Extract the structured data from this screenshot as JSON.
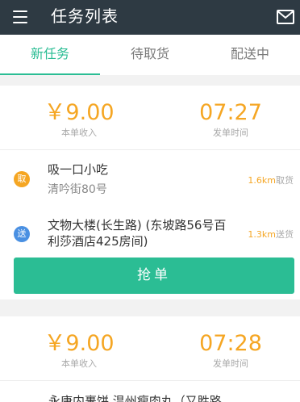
{
  "header": {
    "title": "任务列表",
    "menu_icon": "menu-icon",
    "mail_icon": "mail-icon"
  },
  "tabs": [
    {
      "label": "新任务",
      "active": true
    },
    {
      "label": "待取货",
      "active": false
    },
    {
      "label": "配送中",
      "active": false
    }
  ],
  "orders": [
    {
      "income": "￥9.00",
      "income_label": "本单收入",
      "time": "07:27",
      "time_label": "发单时间",
      "pickup": {
        "badge": "取",
        "name": "吸一口小吃",
        "address": "清吟街80号",
        "distance": "1.6km",
        "distance_label": "取货"
      },
      "delivery": {
        "badge": "送",
        "address_line1": "文物大楼(长生路) (东坡路56号百",
        "address_line2": "利莎酒店425房间)",
        "distance": "1.3km",
        "distance_label": "送货"
      },
      "action": "抢单"
    },
    {
      "income": "￥9.00",
      "income_label": "本单收入",
      "time": "07:28",
      "time_label": "发单时间",
      "pickup_partial": "永康内裹饼 温州瘦肉丸（又胜路"
    }
  ],
  "colors": {
    "accent": "#2bbd94",
    "money": "#f5a623",
    "topbar": "#2e3a43",
    "deliver_badge": "#4a90e2"
  }
}
